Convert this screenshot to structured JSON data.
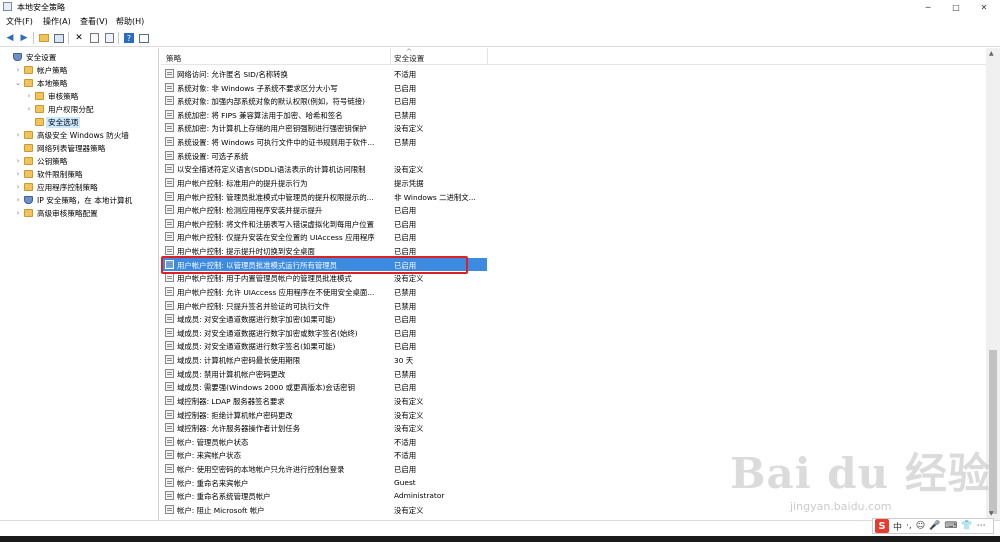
{
  "window": {
    "title": "本地安全策略",
    "minimize": "─",
    "maximize": "□",
    "close": "✕"
  },
  "menu": [
    "文件(F)",
    "操作(A)",
    "查看(V)",
    "帮助(H)"
  ],
  "tree": [
    {
      "label": "安全设置",
      "level": 0,
      "icon": "shield-icon",
      "expander": ""
    },
    {
      "label": "帐户策略",
      "level": 1,
      "icon": "folder-icon",
      "expander": "›"
    },
    {
      "label": "本地策略",
      "level": 1,
      "icon": "folder-icon",
      "expander": "⌄"
    },
    {
      "label": "审核策略",
      "level": 2,
      "icon": "folder-icon",
      "expander": "›"
    },
    {
      "label": "用户权限分配",
      "level": 2,
      "icon": "folder-icon",
      "expander": "›"
    },
    {
      "label": "安全选项",
      "level": 2,
      "icon": "folder-icon",
      "expander": "",
      "selected": true
    },
    {
      "label": "高级安全 Windows 防火墙",
      "level": 1,
      "icon": "folder-icon",
      "expander": "›"
    },
    {
      "label": "网络列表管理器策略",
      "level": 1,
      "icon": "folder-icon",
      "expander": ""
    },
    {
      "label": "公钥策略",
      "level": 1,
      "icon": "folder-icon",
      "expander": "›"
    },
    {
      "label": "软件限制策略",
      "level": 1,
      "icon": "folder-icon",
      "expander": "›"
    },
    {
      "label": "应用程序控制策略",
      "level": 1,
      "icon": "folder-icon",
      "expander": "›"
    },
    {
      "label": "IP 安全策略，在 本地计算机",
      "level": 1,
      "icon": "shield-icon",
      "expander": "›"
    },
    {
      "label": "高级审核策略配置",
      "level": 1,
      "icon": "folder-icon",
      "expander": "›"
    }
  ],
  "list": {
    "header_policy": "策略",
    "header_setting": "安全设置",
    "sort_indicator": "^",
    "rows": [
      {
        "policy": "网络访问: 允许匿名 SID/名称转换",
        "setting": "不适用"
      },
      {
        "policy": "系统对象: 非 Windows 子系统不要求区分大小写",
        "setting": "已启用"
      },
      {
        "policy": "系统对象: 加强内部系统对象的默认权限(例如，符号链接)",
        "setting": "已启用"
      },
      {
        "policy": "系统加密: 将 FIPS 兼容算法用于加密、哈希和签名",
        "setting": "已禁用"
      },
      {
        "policy": "系统加密: 为计算机上存储的用户密钥强制进行强密钥保护",
        "setting": "没有定义"
      },
      {
        "policy": "系统设置: 将 Windows 可执行文件中的证书规则用于软件...",
        "setting": "已禁用"
      },
      {
        "policy": "系统设置: 可选子系统",
        "setting": ""
      },
      {
        "policy": "以安全描述符定义语言(SDDL)语法表示的计算机访问限制",
        "setting": "没有定义"
      },
      {
        "policy": "用户帐户控制: 标准用户的提升提示行为",
        "setting": "提示凭据"
      },
      {
        "policy": "用户帐户控制: 管理员批准模式中管理员的提升权限提示的...",
        "setting": "非 Windows 二进制文..."
      },
      {
        "policy": "用户帐户控制: 检测应用程序安装并提示提升",
        "setting": "已启用"
      },
      {
        "policy": "用户帐户控制: 将文件和注册表写入错误虚拟化到每用户位置",
        "setting": "已启用"
      },
      {
        "policy": "用户帐户控制: 仅提升安装在安全位置的 UIAccess 应用程序",
        "setting": "已启用"
      },
      {
        "policy": "用户帐户控制: 提示提升时切换到安全桌面",
        "setting": "已启用"
      },
      {
        "policy": "用户帐户控制: 以管理员批准模式运行所有管理员",
        "setting": "已启用",
        "selected": true
      },
      {
        "policy": "用户帐户控制: 用于内置管理员帐户的管理员批准模式",
        "setting": "没有定义"
      },
      {
        "policy": "用户帐户控制: 允许 UIAccess 应用程序在不使用安全桌面...",
        "setting": "已禁用"
      },
      {
        "policy": "用户帐户控制: 只提升签名并验证的可执行文件",
        "setting": "已禁用"
      },
      {
        "policy": "域成员: 对安全通道数据进行数字加密(如果可能)",
        "setting": "已启用"
      },
      {
        "policy": "域成员: 对安全通道数据进行数字加密或数字签名(始终)",
        "setting": "已启用"
      },
      {
        "policy": "域成员: 对安全通道数据进行数字签名(如果可能)",
        "setting": "已启用"
      },
      {
        "policy": "域成员: 计算机帐户密码最长使用期限",
        "setting": "30 天"
      },
      {
        "policy": "域成员: 禁用计算机帐户密码更改",
        "setting": "已禁用"
      },
      {
        "policy": "域成员: 需要强(Windows 2000 或更高版本)会话密钥",
        "setting": "已启用"
      },
      {
        "policy": "域控制器: LDAP 服务器签名要求",
        "setting": "没有定义"
      },
      {
        "policy": "域控制器: 拒绝计算机帐户密码更改",
        "setting": "没有定义"
      },
      {
        "policy": "域控制器: 允许服务器操作者计划任务",
        "setting": "没有定义"
      },
      {
        "policy": "帐户: 管理员帐户状态",
        "setting": "不适用"
      },
      {
        "policy": "帐户: 来宾帐户状态",
        "setting": "不适用"
      },
      {
        "policy": "帐户: 使用空密码的本地帐户只允许进行控制台登录",
        "setting": "已启用"
      },
      {
        "policy": "帐户: 重命名来宾帐户",
        "setting": "Guest"
      },
      {
        "policy": "帐户: 重命名系统管理员帐户",
        "setting": "Administrator"
      },
      {
        "policy": "帐户: 阻止 Microsoft 帐户",
        "setting": "没有定义"
      }
    ]
  },
  "watermark": {
    "brand": "Bai du 经验",
    "url": "jingyan.baidu.com"
  },
  "ime": {
    "logo": "S",
    "mode": "中",
    "punct": "·,",
    "emoji": "☺",
    "mic": "🎤",
    "keyboard": "⌨",
    "user": "👕",
    "more": "⋯"
  }
}
